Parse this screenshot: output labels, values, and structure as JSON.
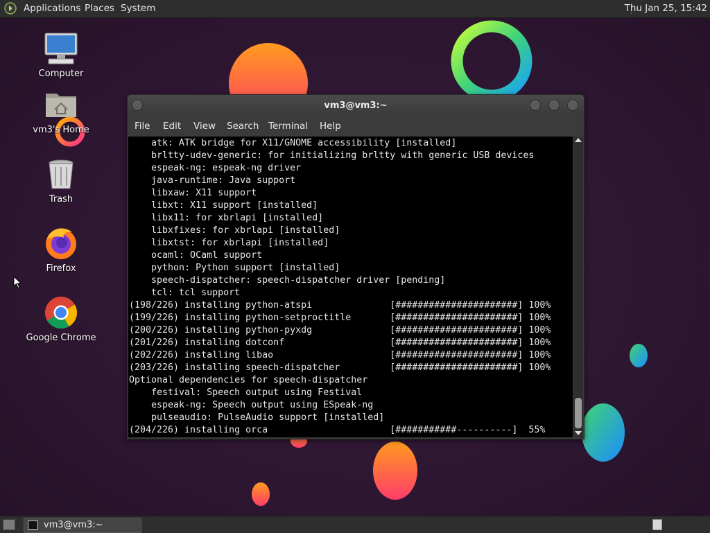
{
  "top_panel": {
    "menus": [
      "Applications",
      "Places",
      "System"
    ],
    "clock": "Thu Jan 25, 15:42"
  },
  "desktop": {
    "icons": [
      {
        "label": "Computer",
        "icon": "computer-icon"
      },
      {
        "label": "vm3's Home",
        "icon": "home-folder-icon"
      },
      {
        "label": "Trash",
        "icon": "trash-icon"
      },
      {
        "label": "Firefox",
        "icon": "firefox-icon"
      },
      {
        "label": "Google Chrome",
        "icon": "chrome-icon"
      }
    ]
  },
  "terminal": {
    "title": "vm3@vm3:~",
    "menu": [
      "File",
      "Edit",
      "View",
      "Search",
      "Terminal",
      "Help"
    ],
    "lines": [
      "    atk: ATK bridge for X11/GNOME accessibility [installed]",
      "    brltty-udev-generic: for initializing brltty with generic USB devices",
      "    espeak-ng: espeak-ng driver",
      "    java-runtime: Java support",
      "    libxaw: X11 support",
      "    libxt: X11 support [installed]",
      "    libx11: for xbrlapi [installed]",
      "    libxfixes: for xbrlapi [installed]",
      "    libxtst: for xbrlapi [installed]",
      "    ocaml: OCaml support",
      "    python: Python support [installed]",
      "    speech-dispatcher: speech-dispatcher driver [pending]",
      "    tcl: tcl support",
      "(198/226) installing python-atspi              [######################] 100%",
      "(199/226) installing python-setproctitle       [######################] 100%",
      "(200/226) installing python-pyxdg              [######################] 100%",
      "(201/226) installing dotconf                   [######################] 100%",
      "(202/226) installing libao                     [######################] 100%",
      "(203/226) installing speech-dispatcher         [######################] 100%",
      "Optional dependencies for speech-dispatcher",
      "    festival: Speech output using Festival",
      "    espeak-ng: Speech output using ESpeak-ng",
      "    pulseaudio: PulseAudio support [installed]",
      "(204/226) installing orca                      [###########----------]  55%"
    ]
  },
  "bottom_panel": {
    "task_label": "vm3@vm3:~"
  },
  "colors": {
    "wallpaper": "#2b1530",
    "panel": "#2e2e2e",
    "terminal_bg": "#000000",
    "terminal_fg": "#e6e6e6"
  }
}
